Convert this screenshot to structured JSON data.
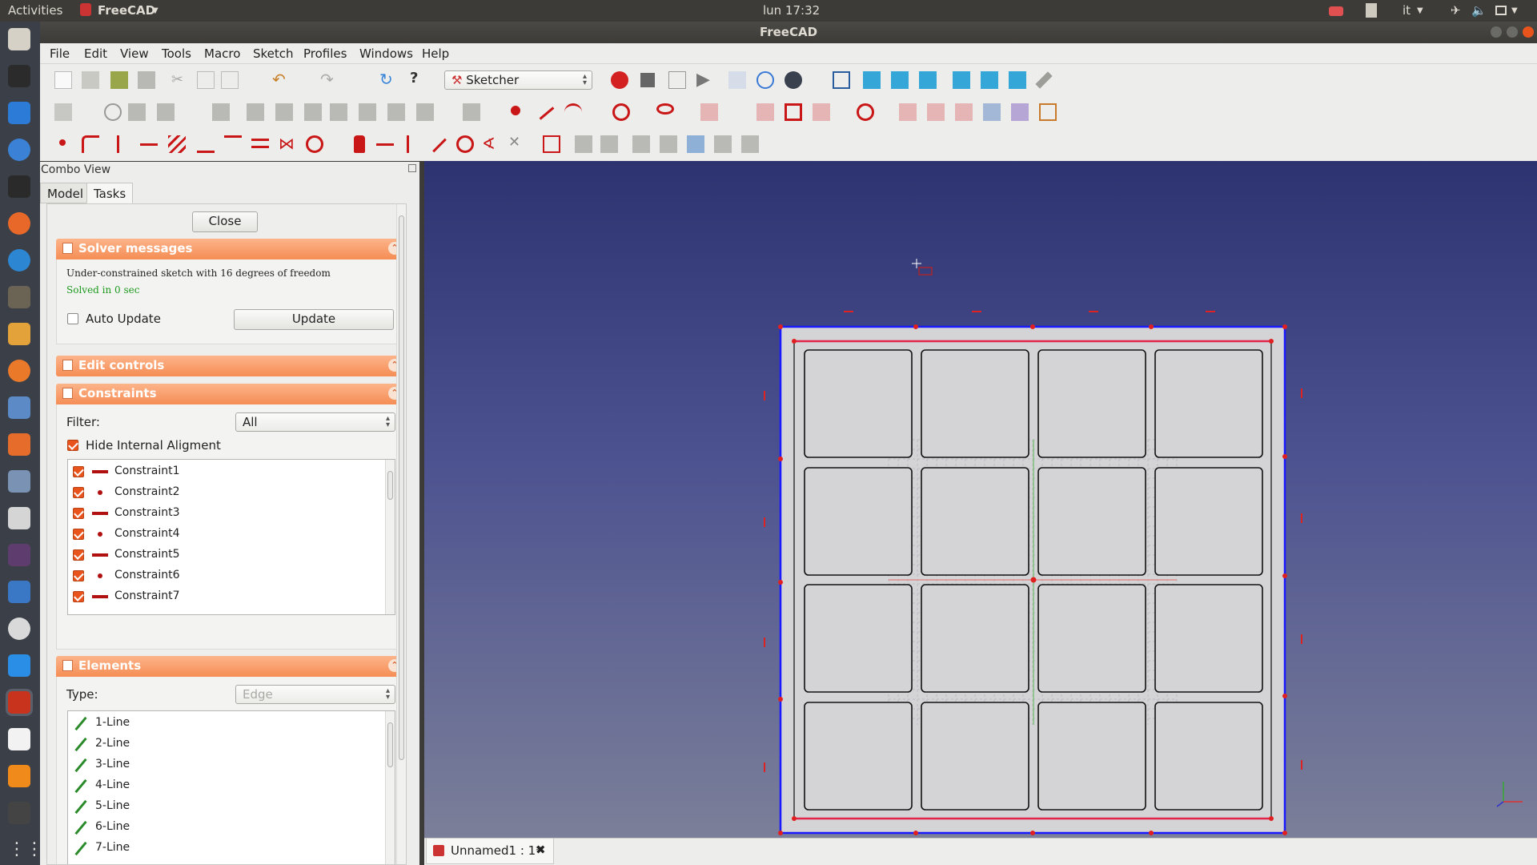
{
  "topbar": {
    "activities": "Activities",
    "app_name": "FreeCAD",
    "clock": "lun 17:32",
    "keyboard_layout": "it"
  },
  "window": {
    "title": "FreeCAD"
  },
  "menu": [
    "File",
    "Edit",
    "View",
    "Tools",
    "Macro",
    "Sketch",
    "Profiles",
    "Windows",
    "Help"
  ],
  "workbench": {
    "selected": "Sketcher"
  },
  "combo": {
    "title": "Combo View",
    "tabs": [
      "Model",
      "Tasks"
    ],
    "active_tab": "Tasks",
    "close_label": "Close"
  },
  "solver": {
    "title": "Solver messages",
    "message": "Under-constrained sketch with 16 degrees of freedom",
    "solved": "Solved in 0 sec",
    "auto_update_label": "Auto Update",
    "auto_update_checked": false,
    "update_label": "Update"
  },
  "edit_controls": {
    "title": "Edit controls"
  },
  "constraints": {
    "title": "Constraints",
    "filter_label": "Filter:",
    "filter_value": "All",
    "hide_internal_label": "Hide Internal Aligment",
    "hide_internal_checked": true,
    "items": [
      {
        "label": "Constraint1",
        "icon": "horizontal-constraint-icon"
      },
      {
        "label": "Constraint2",
        "icon": "coincident-constraint-icon"
      },
      {
        "label": "Constraint3",
        "icon": "horizontal-constraint-icon"
      },
      {
        "label": "Constraint4",
        "icon": "coincident-constraint-icon"
      },
      {
        "label": "Constraint5",
        "icon": "horizontal-constraint-icon"
      },
      {
        "label": "Constraint6",
        "icon": "coincident-constraint-icon"
      },
      {
        "label": "Constraint7",
        "icon": "horizontal-constraint-icon"
      }
    ]
  },
  "elements": {
    "title": "Elements",
    "type_label": "Type:",
    "type_value": "Edge",
    "items": [
      "1-Line",
      "2-Line",
      "3-Line",
      "4-Line",
      "5-Line",
      "6-Line",
      "7-Line"
    ]
  },
  "doc_tab": {
    "label": "Unnamed1 : 1*"
  },
  "colors": {
    "sketch_outer": "#1a1aff",
    "sketch_inner": "#e0244a",
    "cell_fill": "#d4d4d6",
    "view_top": "#2d3370",
    "view_bottom": "#7b7f99",
    "section_header": "#f58d55"
  }
}
